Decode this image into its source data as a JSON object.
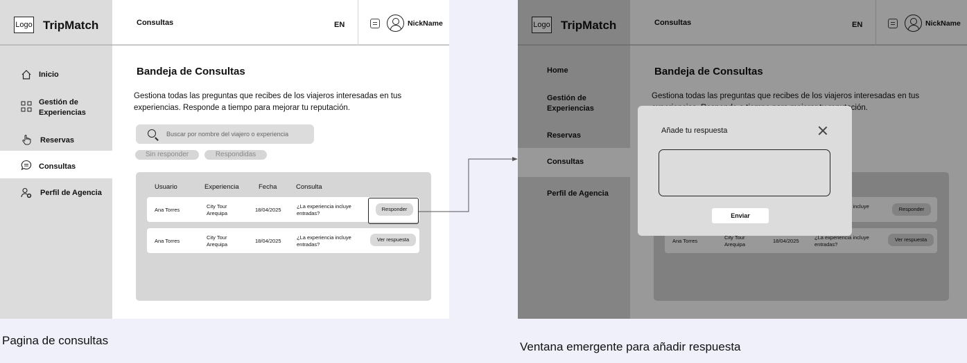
{
  "brand": {
    "logo_text": "Logo",
    "name": "TripMatch"
  },
  "header": {
    "title": "Consultas",
    "language": "EN",
    "username": "NickName"
  },
  "sidebar_a": {
    "items": [
      {
        "label": "Inicio",
        "icon": "home-icon"
      },
      {
        "label": "Gestión de Experiencias",
        "icon": "grid-icon"
      },
      {
        "label": "Reservas",
        "icon": "hand-pointer-icon"
      },
      {
        "label": "Consultas",
        "icon": "chat-icon",
        "active": true
      },
      {
        "label": "Perfil de Agencia",
        "icon": "user-settings-icon"
      }
    ]
  },
  "sidebar_b": {
    "items": [
      {
        "label": "Home"
      },
      {
        "label": "Gestión de Experiencias"
      },
      {
        "label": "Reservas"
      },
      {
        "label": "Consultas",
        "active": true
      },
      {
        "label": "Perfil de Agencia"
      }
    ]
  },
  "main": {
    "title": "Bandeja de Consultas",
    "description": "Gestiona todas las preguntas que recibes de los viajeros interesadas en tus experiencias. Responde a tiempo para mejorar tu reputación.",
    "search_placeholder": "Buscar por nombre del viajero o experiencia",
    "filters": [
      "Sin responder",
      "Respondidas"
    ]
  },
  "table": {
    "headers": [
      "Usuario",
      "Experiencia",
      "Fecha",
      "Consulta"
    ],
    "rows": [
      {
        "usuario": "Ana Torres",
        "experiencia": "City Tour Arequipa",
        "fecha": "18/04/2025",
        "consulta": "¿La experiencia incluye entradas?",
        "action": "Responder"
      },
      {
        "usuario": "Ana Torres",
        "experiencia": "City Tour Arequipa",
        "fecha": "18/04/2025",
        "consulta": "¿La experiencia incluye entradas?",
        "action": "Ver respuesta"
      }
    ]
  },
  "modal": {
    "title": "Añade tu respuesta",
    "submit_label": "Enviar"
  },
  "captions": {
    "left": "Pagina de consultas",
    "right": "Ventana emergente para añadir respuesta"
  },
  "colors": {
    "background": "#f0f0fa",
    "sidebar": "#dcdcdc",
    "panel": "#d6d6d6",
    "overlay": "rgba(0,0,0,0.4)"
  }
}
